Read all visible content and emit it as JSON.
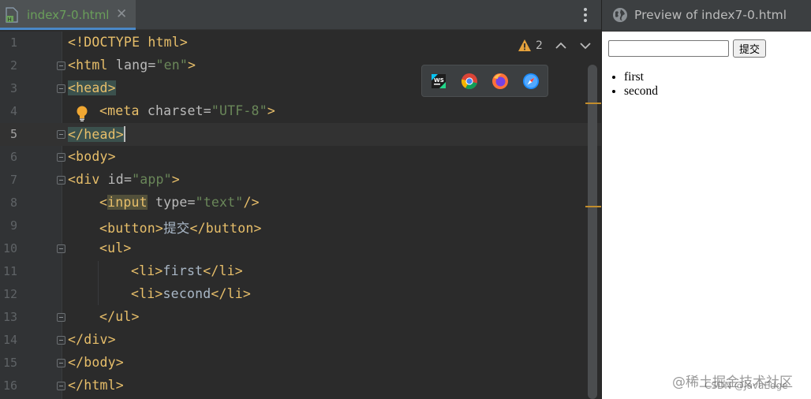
{
  "editor": {
    "tab": {
      "label": "index7-0.html",
      "close": "✕"
    },
    "warnings": {
      "count": "2"
    },
    "lines": [
      {
        "num": "1"
      },
      {
        "num": "2"
      },
      {
        "num": "3"
      },
      {
        "num": "4"
      },
      {
        "num": "5"
      },
      {
        "num": "6"
      },
      {
        "num": "7"
      },
      {
        "num": "8"
      },
      {
        "num": "9"
      },
      {
        "num": "10"
      },
      {
        "num": "11"
      },
      {
        "num": "12"
      },
      {
        "num": "13"
      },
      {
        "num": "14"
      },
      {
        "num": "15"
      },
      {
        "num": "16"
      }
    ],
    "code": {
      "l1": "<!DOCTYPE html>",
      "l2_tag": "<html ",
      "l2_attr": "lang=",
      "l2_val": "\"en\"",
      "l2_end": ">",
      "l3": "<head>",
      "l4_tag": "<meta ",
      "l4_attr": "charset=",
      "l4_val": "\"UTF-8\"",
      "l4_end": ">",
      "l5": "</head>",
      "l6": "<body>",
      "l7_tag": "<div ",
      "l7_attr": "id=",
      "l7_val": "\"app\"",
      "l7_end": ">",
      "l8_open": "<",
      "l8_name": "input",
      "l8_attr": " type=",
      "l8_val": "\"text\"",
      "l8_end": "/>",
      "l9_open": "<button>",
      "l9_text": "提交",
      "l9_close": "</button>",
      "l10": "<ul>",
      "l11_open": "<li>",
      "l11_text": "first",
      "l11_close": "</li>",
      "l12_open": "<li>",
      "l12_text": "second",
      "l12_close": "</li>",
      "l13": "</ul>",
      "l14": "</div>",
      "l15": "</body>",
      "l16": "</html>"
    },
    "colors": {
      "tag": "#e8bf6a",
      "attr": "#bababa",
      "value": "#6a8759",
      "accent": "#4a88c7"
    }
  },
  "browsers": [
    {
      "icon": "jetbrains-icon"
    },
    {
      "icon": "chrome-icon"
    },
    {
      "icon": "firefox-icon"
    },
    {
      "icon": "safari-icon"
    }
  ],
  "preview": {
    "title": "Preview of index7-0.html",
    "input_value": "",
    "button_label": "提交",
    "list_items": [
      "first",
      "second"
    ]
  },
  "watermark": {
    "text": "@稀土掘金技术社区",
    "sub": "CSDN @JavaEdge"
  }
}
